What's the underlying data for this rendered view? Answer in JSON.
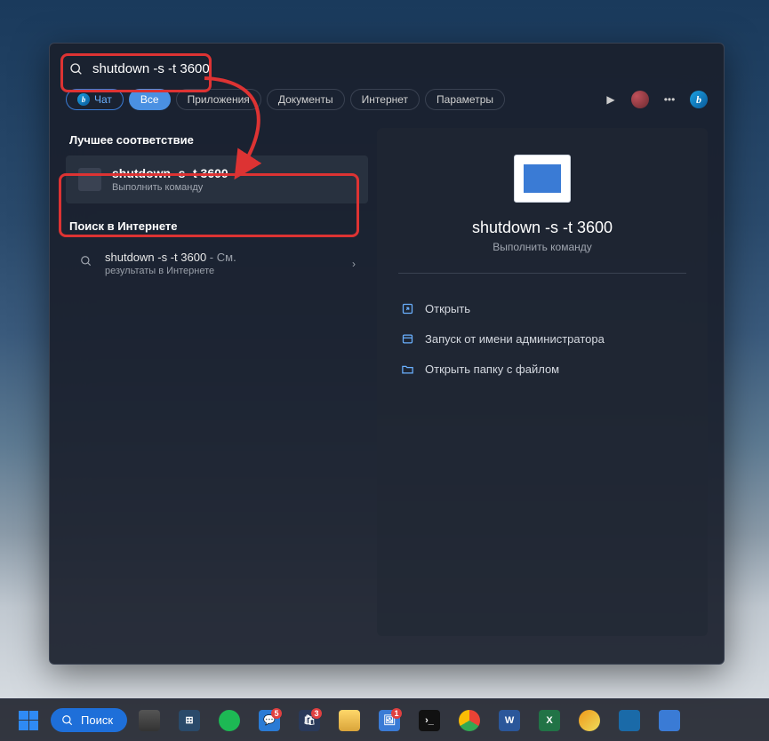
{
  "search": {
    "value": "shutdown -s -t 3600"
  },
  "filters": {
    "chat": "Чат",
    "all": "Все",
    "apps": "Приложения",
    "docs": "Документы",
    "web": "Интернет",
    "settings": "Параметры"
  },
  "left": {
    "best_match_heading": "Лучшее соответствие",
    "result": {
      "title": "shutdown -s -t 3600",
      "subtitle": "Выполнить команду"
    },
    "web_heading": "Поиск в Интернете",
    "web_item": {
      "title": "shutdown -s -t 3600",
      "suffix": " - См.",
      "line2": "результаты в Интернете"
    }
  },
  "preview": {
    "title": "shutdown -s -t 3600",
    "subtitle": "Выполнить команду",
    "actions": {
      "open": "Открыть",
      "admin": "Запуск от имени администратора",
      "folder": "Открыть папку с файлом"
    }
  },
  "taskbar": {
    "search_label": "Поиск",
    "badges": {
      "messages": "5",
      "store": "3",
      "photos": "1"
    }
  }
}
